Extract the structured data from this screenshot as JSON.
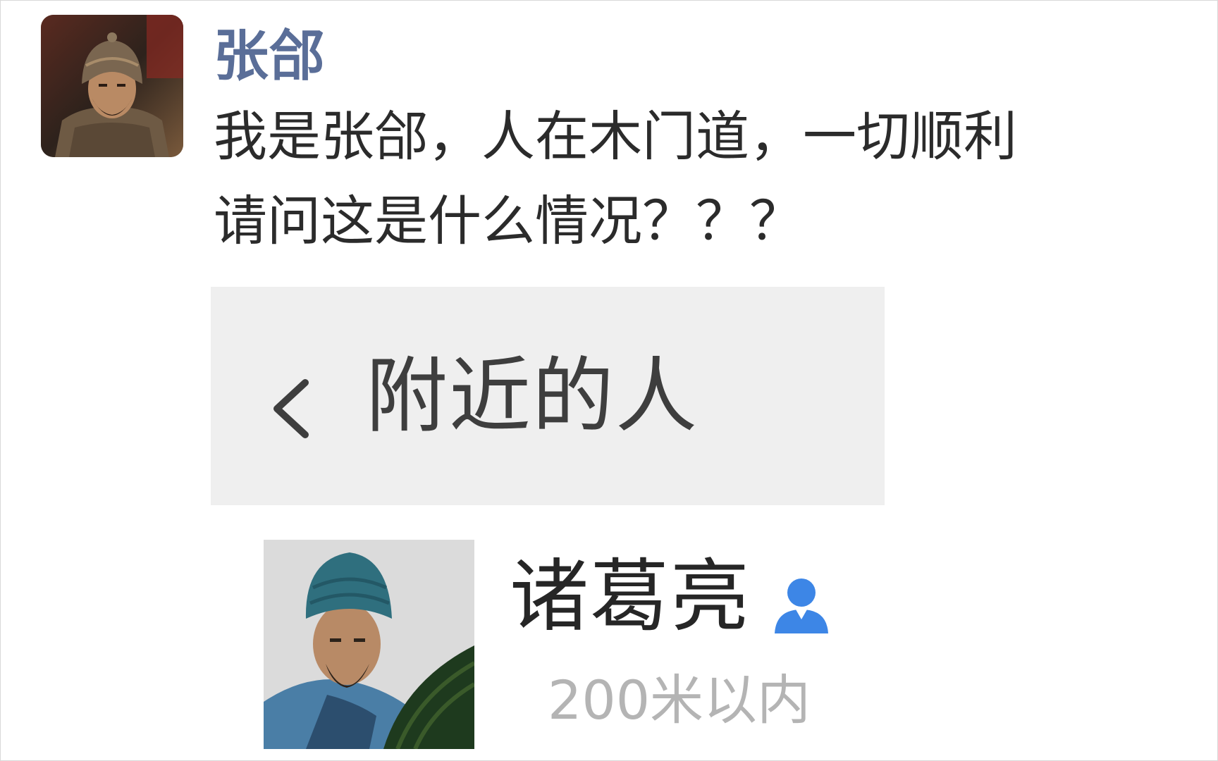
{
  "sender": {
    "name": "张郃",
    "avatar_icon": "general-portrait-avatar"
  },
  "message": {
    "line1": "我是张郃，人在木门道，一切顺利",
    "line2": "请问这是什么情况？？？"
  },
  "attachment": {
    "header": {
      "back_icon": "chevron-left-icon",
      "title": "附近的人"
    },
    "person": {
      "name": "诸葛亮",
      "avatar_icon": "strategist-portrait-avatar",
      "badge_icon": "person-icon",
      "badge_color": "#3d86e6",
      "distance": "200米以内"
    }
  },
  "colors": {
    "sender_name": "#5a6e98",
    "header_background": "#efefef"
  }
}
